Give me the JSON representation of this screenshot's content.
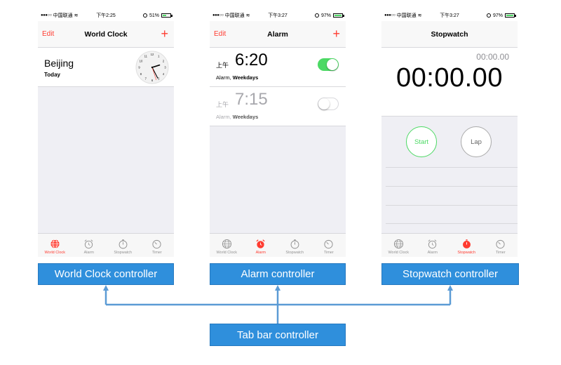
{
  "colors": {
    "accent_red": "#ff3b30",
    "toggle_green": "#4cd964",
    "label_blue": "#2f8fdc",
    "arrow_blue": "#5b9bd5"
  },
  "phones": {
    "worldclock": {
      "status": {
        "carrier": "中国联通",
        "time": "下午2:25",
        "battery": "51%",
        "battery_level": 0.51
      },
      "nav": {
        "edit": "Edit",
        "title": "World Clock",
        "add": "+"
      },
      "clock": {
        "city": "Beijing",
        "day": "Today",
        "hour": 14,
        "minute": 25,
        "second": 27
      }
    },
    "alarm": {
      "status": {
        "carrier": "中国联通",
        "time": "下午3:27",
        "battery": "97%",
        "battery_level": 0.97
      },
      "nav": {
        "edit": "Edit",
        "title": "Alarm",
        "add": "+"
      },
      "alarms": [
        {
          "prefix": "上午",
          "time": "6:20",
          "label": "Alarm,",
          "days": "Weekdays",
          "enabled": true
        },
        {
          "prefix": "上午",
          "time": "7:15",
          "label": "Alarm,",
          "days": "Weekdays",
          "enabled": false
        }
      ]
    },
    "stopwatch": {
      "status": {
        "carrier": "中国联通",
        "time": "下午3:27",
        "battery": "97%",
        "battery_level": 0.97
      },
      "nav": {
        "title": "Stopwatch"
      },
      "lap_time": "00:00.00",
      "main_time": "00:00.00",
      "start": "Start",
      "lap": "Lap"
    }
  },
  "tabs": [
    "World Clock",
    "Alarm",
    "Stopwatch",
    "Timer"
  ],
  "tab_icons": [
    "globe-icon",
    "alarm-clock-icon",
    "stopwatch-icon",
    "timer-icon"
  ],
  "labels": {
    "worldclock": "World Clock controller",
    "alarm": "Alarm controller",
    "stopwatch": "Stopwatch controller",
    "tabbar": "Tab bar controller"
  }
}
